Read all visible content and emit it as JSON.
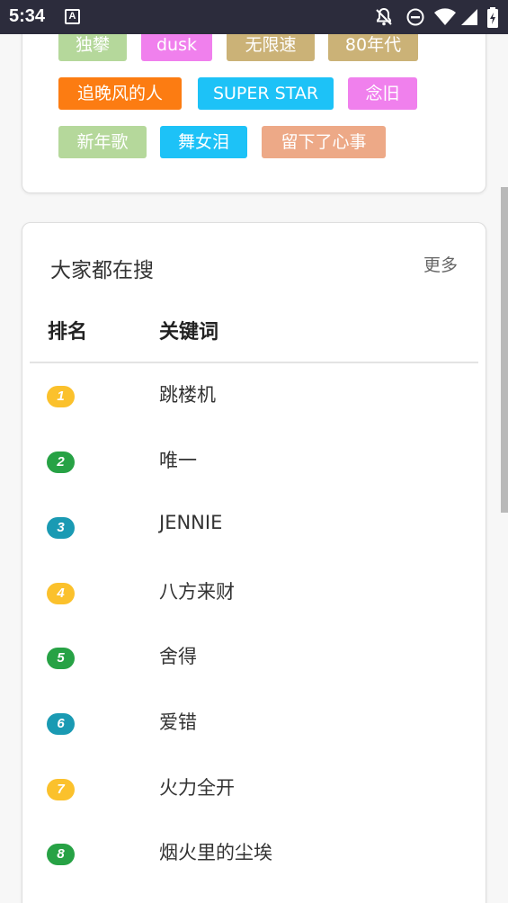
{
  "status_bar": {
    "time": "5:34",
    "notification_icon_letter": "A",
    "icons": [
      "notifications-off-icon",
      "do-not-disturb-icon",
      "wifi-icon",
      "signal-icon",
      "battery-icon"
    ]
  },
  "tags_card": {
    "tags": [
      {
        "label": "独攀",
        "color": "#b5d89b"
      },
      {
        "label": "dusk",
        "color": "#f080ed"
      },
      {
        "label": "无限速",
        "color": "#cbb277"
      },
      {
        "label": "80年代",
        "color": "#cbb277"
      },
      {
        "label": "追晚风的人",
        "color": "#fc7c12"
      },
      {
        "label": "SUPER STAR",
        "color": "#1dc2f7"
      },
      {
        "label": "念旧",
        "color": "#f080ed"
      },
      {
        "label": "新年歌",
        "color": "#b5d89b"
      },
      {
        "label": "舞女泪",
        "color": "#1dc2f7"
      },
      {
        "label": "留下了心事",
        "color": "#eda987"
      }
    ]
  },
  "hot_search": {
    "title": "大家都在搜",
    "more_label": "更多",
    "columns": {
      "rank": "排名",
      "keyword": "关键词"
    },
    "rows": [
      {
        "rank": "1",
        "keyword": "跳楼机",
        "badge_color": "#fbc12c"
      },
      {
        "rank": "2",
        "keyword": "唯一",
        "badge_color": "#27a245"
      },
      {
        "rank": "3",
        "keyword": "JENNIE",
        "badge_color": "#1a9ab3"
      },
      {
        "rank": "4",
        "keyword": "八方来财",
        "badge_color": "#fbc12c"
      },
      {
        "rank": "5",
        "keyword": "舍得",
        "badge_color": "#27a245"
      },
      {
        "rank": "6",
        "keyword": "爱错",
        "badge_color": "#1a9ab3"
      },
      {
        "rank": "7",
        "keyword": "火力全开",
        "badge_color": "#fbc12c"
      },
      {
        "rank": "8",
        "keyword": "烟火里的尘埃",
        "badge_color": "#27a245"
      }
    ]
  }
}
